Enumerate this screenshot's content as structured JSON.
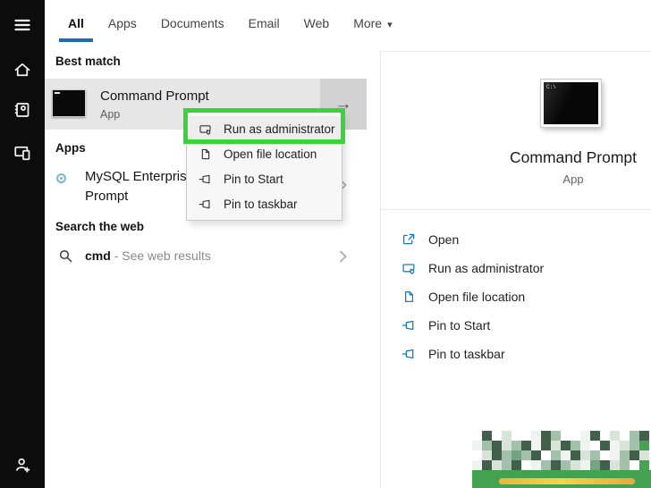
{
  "colors": {
    "accent": "#1f6cb5",
    "highlight_green": "#3bd33b",
    "action_icon_blue": "#1d79c0"
  },
  "icons": {
    "arrow_right": "→",
    "dropdown_caret": "▾",
    "prompt_glyph": "C:\\"
  },
  "tabs": {
    "items": [
      {
        "label": "All",
        "active": true
      },
      {
        "label": "Apps"
      },
      {
        "label": "Documents"
      },
      {
        "label": "Email"
      },
      {
        "label": "Web"
      },
      {
        "label": "More",
        "has_dropdown": true
      }
    ]
  },
  "sidebar": {
    "icons": [
      "menu",
      "home",
      "journal",
      "devices",
      "account-add"
    ]
  },
  "best_match": {
    "header": "Best match",
    "app_name": "Command Prompt",
    "app_type": "App"
  },
  "apps_section": {
    "header": "Apps",
    "item_line1": "MySQL Enterpris",
    "item_line2": "Prompt"
  },
  "web_section": {
    "header": "Search the web",
    "query": "cmd",
    "suffix": "- See web results"
  },
  "context_menu": {
    "items": [
      {
        "label": "Run as administrator",
        "icon": "run-as-admin-icon",
        "highlighted": true
      },
      {
        "label": "Open file location",
        "icon": "file-location-icon"
      },
      {
        "label": "Pin to Start",
        "icon": "pin-icon"
      },
      {
        "label": "Pin to taskbar",
        "icon": "pin-icon"
      }
    ]
  },
  "preview": {
    "app_name": "Command Prompt",
    "app_type": "App",
    "actions": [
      {
        "label": "Open",
        "icon": "open-icon"
      },
      {
        "label": "Run as administrator",
        "icon": "run-as-admin-icon"
      },
      {
        "label": "Open file location",
        "icon": "file-location-icon"
      },
      {
        "label": "Pin to Start",
        "icon": "pin-icon"
      },
      {
        "label": "Pin to taskbar",
        "icon": "pin-icon"
      }
    ]
  },
  "watermark": {
    "palette": {
      "w": "#f0f4f0",
      "l": "#d8e3d9",
      "g": "#a3c1aa",
      "m": "#74a381",
      "d": "#597c63",
      "D": "#425f4b",
      "G": "#45a351"
    },
    "rows": [
      ".D.l..wDg..wD.l.gD",
      "wgDlgDwDlDgw.DwlgG",
      ".lDgmgD.gwDlg.wgDl",
      "wDlgD.wgDglwmDlg.G"
    ]
  }
}
